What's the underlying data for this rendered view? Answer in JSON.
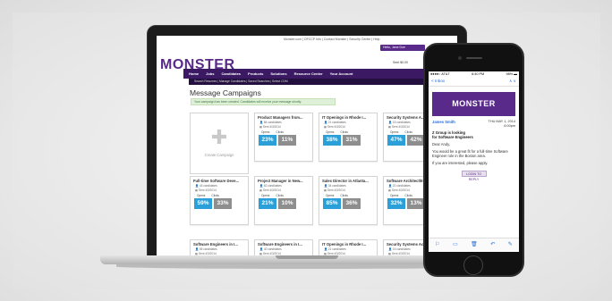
{
  "site": {
    "logo": "MONSTER",
    "top_links": "Monster.com | OFCCP Info | Contact Monster | Security Center | Help",
    "user": "Hello, Jane Doe",
    "credits": "Sent $0.00",
    "nav": [
      "Home",
      "Jobs",
      "Candidates",
      "Products",
      "Solutions",
      "Resource Center",
      "Your Account"
    ],
    "subnav": "Search Resumes | Manage Candidates | Saved Searches | Select CDM",
    "page_title": "Message Campaigns",
    "notice": "Your campaign has been created. Candidates will receive your message shortly."
  },
  "create_label": "Create Campaign",
  "campaign_labels": {
    "opens": "Opens",
    "clicks": "Clicks"
  },
  "campaigns": [
    {
      "title": "Product Managers from...",
      "candidates": "84 candidates",
      "sent": "Sent 4/3/2014",
      "opens": "23%",
      "clicks": "11%"
    },
    {
      "title": "IT Openings in Rhode I...",
      "candidates": "21 candidates",
      "sent": "Sent 4/3/2014",
      "opens": "38%",
      "clicks": "31%"
    },
    {
      "title": "Security Systems A...",
      "candidates": "15 candidates",
      "sent": "Sent 4/3/2014",
      "opens": "47%",
      "clicks": "42%"
    },
    {
      "title": "Full-time Software Deve...",
      "candidates": "43 candidates",
      "sent": "Sent 4/3/2014",
      "opens": "59%",
      "clicks": "33%"
    },
    {
      "title": "Project Manager in New...",
      "candidates": "62 candidates",
      "sent": "Sent 4/3/2014",
      "opens": "21%",
      "clicks": "10%"
    },
    {
      "title": "Sales Director in Atlanta...",
      "candidates": "34 candidates",
      "sent": "Sent 4/3/2014",
      "opens": "85%",
      "clicks": "36%"
    },
    {
      "title": "Software Architect/E...",
      "candidates": "22 candidates",
      "sent": "Sent 4/3/2014",
      "opens": "32%",
      "clicks": "13%"
    },
    {
      "title": "Software Engineers in I...",
      "candidates": "55 candidates",
      "sent": "Sent 4/3/2014",
      "opens": "52%",
      "clicks": "36%"
    },
    {
      "title": "Software Engineers in I...",
      "candidates": "40 candidates",
      "sent": "Sent 4/3/2014",
      "opens": "23%",
      "clicks": "11%"
    },
    {
      "title": "IT Openings in Rhode I...",
      "candidates": "21 candidates",
      "sent": "Sent 4/3/2014",
      "opens": "38%",
      "clicks": "31%"
    },
    {
      "title": "Security Systems Ac...",
      "candidates": "15 candidates",
      "sent": "Sent 4/3/2014",
      "opens": "47%",
      "clicks": "42%"
    }
  ],
  "phone": {
    "carrier": "●●●●○ AT&T",
    "time": "6:40 PM",
    "battery": "98% ▬",
    "back": "< Inbox",
    "arrows": "∧ ∨",
    "banner": "MONSTER",
    "from": "James Smith",
    "date": "THU MAY 1, 2014\n6:00pm",
    "subject": "Z Group is looking\nfor Software Engineers",
    "body1": "Dear Andy,",
    "body2": "You would be a great fit for a full-time Software Engineer role in the Boston area.",
    "body3": "If you are interested, please apply.",
    "cta": "LOGIN TO REPLY",
    "toolbar": [
      "⚐",
      "▭",
      "🗑",
      "↶",
      "✎"
    ]
  }
}
